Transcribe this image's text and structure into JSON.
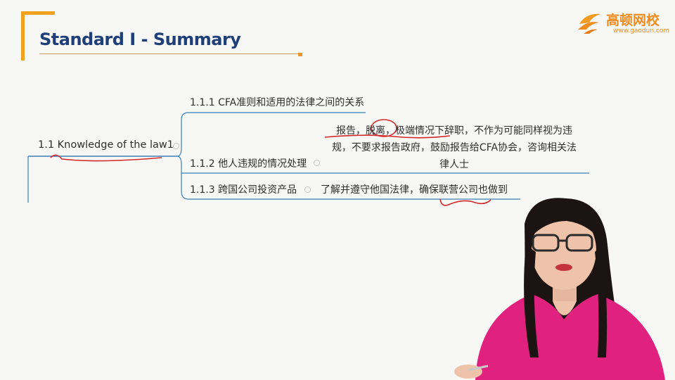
{
  "slide": {
    "title": "Standard I - Summary"
  },
  "logo": {
    "name": "高顿网校",
    "url": "www.gaodun.com"
  },
  "mind_map": {
    "root": "1.1 Knowledge of the law1",
    "branches": [
      {
        "label": "1.1.1 CFA准则和适用的法律之间的关系",
        "detail": ""
      },
      {
        "label": "1.1.2 他人违规的情况处理",
        "detail_line1": "报告，脱离，极端情况下辞职，不作为可能同样视为违",
        "detail_line2": "规，不要求报告政府，鼓励报告给CFA协会，咨询相关法",
        "detail_line3": "律人士"
      },
      {
        "label": "1.1.3 跨国公司投资产品",
        "detail": "了解并遵守他国法律，确保联营公司也做到"
      }
    ]
  },
  "colors": {
    "title_blue": "#1f3f79",
    "accent_orange": "#f0a21f",
    "connector_blue": "#3b7fb6",
    "annotation_red": "#d12a2a",
    "presenter_top": "#e0227e"
  }
}
